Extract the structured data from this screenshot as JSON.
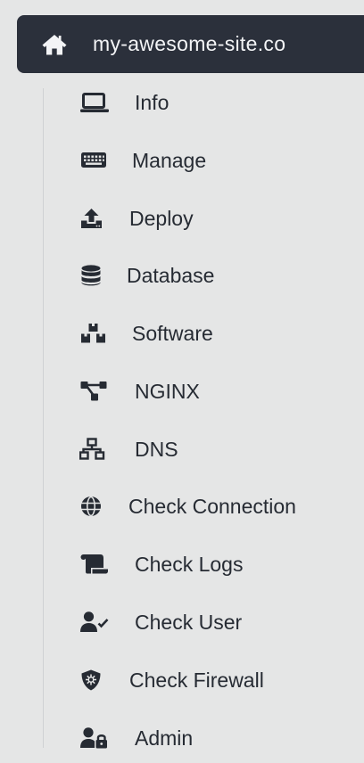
{
  "header": {
    "icon": "home-icon",
    "site_name": "my-awesome-site.co"
  },
  "menu": {
    "items": [
      {
        "label": "Info",
        "icon": "laptop-icon"
      },
      {
        "label": "Manage",
        "icon": "keyboard-icon"
      },
      {
        "label": "Deploy",
        "icon": "upload-icon"
      },
      {
        "label": "Database",
        "icon": "database-icon"
      },
      {
        "label": "Software",
        "icon": "boxes-icon"
      },
      {
        "label": "NGINX",
        "icon": "nodes-icon"
      },
      {
        "label": "DNS",
        "icon": "network-icon"
      },
      {
        "label": "Check Connection",
        "icon": "globe-icon"
      },
      {
        "label": "Check Logs",
        "icon": "scroll-icon"
      },
      {
        "label": "Check User",
        "icon": "user-check-icon"
      },
      {
        "label": "Check Firewall",
        "icon": "shield-virus-icon"
      },
      {
        "label": "Admin",
        "icon": "user-lock-icon"
      }
    ]
  },
  "colors": {
    "background": "#e5e6e6",
    "header_background": "#2b303b",
    "header_text": "#f3f4f6",
    "text": "#262b33"
  }
}
